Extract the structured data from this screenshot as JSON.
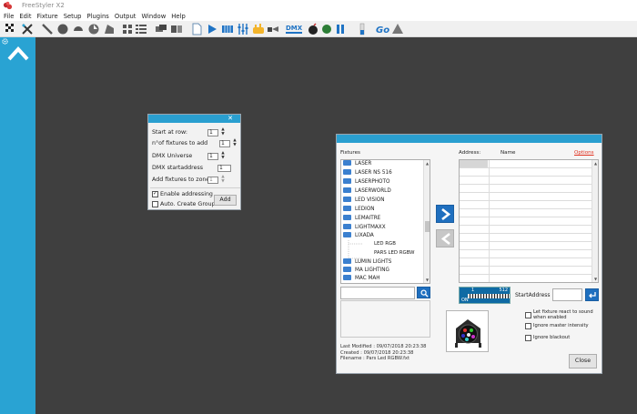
{
  "app": {
    "title": "FreeStyler X2"
  },
  "menu": [
    "File",
    "Edit",
    "Fixture",
    "Setup",
    "Plugins",
    "Output",
    "Window",
    "Help"
  ],
  "toolbar_icons": [
    "select-icon",
    "cross-icon",
    "line-tool-icon",
    "circle-tool-icon",
    "pan-icon",
    "rotate-icon",
    "ramp-icon",
    "grid-view-icon",
    "list-view-icon",
    "group-icon",
    "ungroup-icon",
    "new-file-icon",
    "play-icon",
    "sequence-icon",
    "faders-icon",
    "hands-icon",
    "cue-icon",
    "dmx-in-icon",
    "bomb-icon",
    "pause-icon",
    "level-icon",
    "go-icon",
    "blackout-icon"
  ],
  "toolbar": {
    "dmx_label": "DMX",
    "go_label": "Go"
  },
  "add_fixtures": {
    "close": "✕",
    "start_row_label": "Start at row:",
    "start_row_value": "1",
    "count_label": "n°of fixtures to add",
    "count_value": "1",
    "universe_label": "DMX Universe",
    "universe_value": "1",
    "startaddress_label": "DMX startaddress",
    "startaddress_value": "1",
    "zone_label": "Add fixtures to zone:",
    "zone_value": "1",
    "enable_addressing_label": "Enable addressing",
    "enable_addressing_checked": true,
    "auto_group_label": "Auto. Create Group",
    "auto_group_checked": false,
    "add_button": "Add"
  },
  "fixture_dialog": {
    "fixtures_label": "Fixtures",
    "address_label": "Address:",
    "name_label": "Name",
    "options_link": "Options",
    "tree": [
      {
        "name": "LASER",
        "type": "folder"
      },
      {
        "name": "LASER NS 516",
        "type": "folder"
      },
      {
        "name": "LASERPHOTO",
        "type": "folder"
      },
      {
        "name": "LASERWORLD",
        "type": "folder"
      },
      {
        "name": "LED VISION",
        "type": "folder"
      },
      {
        "name": "LEDION",
        "type": "folder"
      },
      {
        "name": "LEMAITRE",
        "type": "folder"
      },
      {
        "name": "LIGHTMAXX",
        "type": "folder"
      },
      {
        "name": "LIXADA",
        "type": "folder"
      },
      {
        "name": "LED RGB",
        "type": "file"
      },
      {
        "name": "PARS LED RGBW",
        "type": "file"
      },
      {
        "name": "LUMIN LIGHTS",
        "type": "folder"
      },
      {
        "name": "MA LIGHTING",
        "type": "folder"
      },
      {
        "name": "MAC MAH",
        "type": "folder"
      }
    ],
    "dmx_range_start": "1",
    "dmx_range_end": "512",
    "dmx_on_label": "ON",
    "start_address_label": "StartAddress :",
    "sound_label": "Let fixture react to sound when enabled",
    "ignore_master_label": "Ignore master intensity",
    "ignore_blackout_label": "Ignore blackout",
    "last_modified": "Last Modified : 09/07/2018 20:23:38",
    "created": "Created : 09/07/2018 20:23:38",
    "filename": "Filename : Pars Led RGBW.fxt",
    "close_button": "Close"
  }
}
